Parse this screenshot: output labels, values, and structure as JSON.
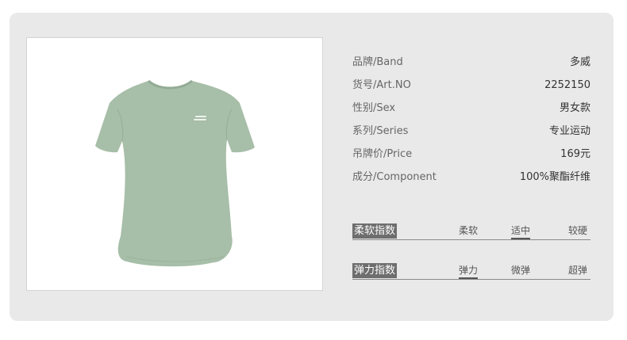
{
  "product": {
    "image_alt": "light sage green short-sleeve t-shirt",
    "shirt_color": "#a7bea8"
  },
  "specs": [
    {
      "label": "品牌/Band",
      "value": "多威"
    },
    {
      "label": "货号/Art.NO",
      "value": "2252150"
    },
    {
      "label": "性别/Sex",
      "value": "男女款"
    },
    {
      "label": "系列/Series",
      "value": "专业运动"
    },
    {
      "label": "吊牌价/Price",
      "value": "169元"
    },
    {
      "label": "成分/Component",
      "value": "100%聚酯纤维"
    }
  ],
  "softness": {
    "title": "柔软指数",
    "options": [
      "柔软",
      "适中",
      "较硬"
    ],
    "selected": "适中"
  },
  "elasticity": {
    "title": "弹力指数",
    "options": [
      "弹力",
      "微弹",
      "超弹"
    ],
    "selected": "弹力"
  }
}
